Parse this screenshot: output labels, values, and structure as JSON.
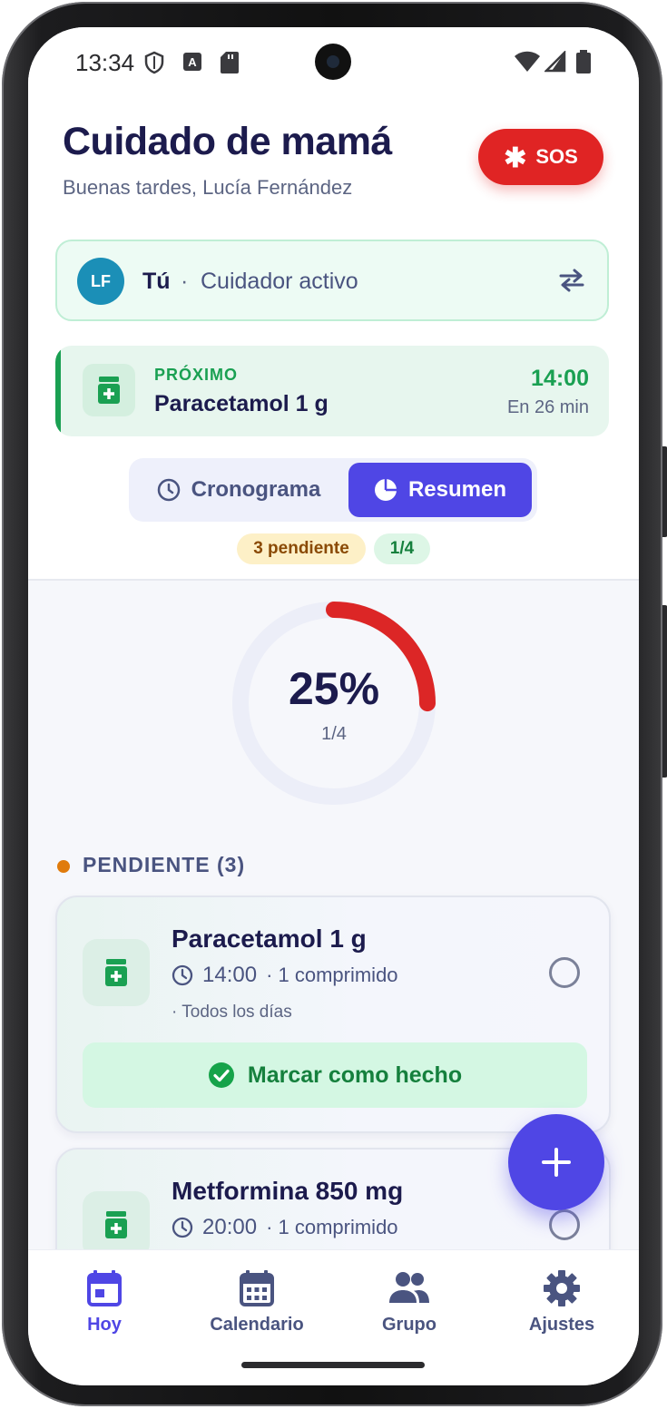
{
  "status_bar": {
    "time": "13:34"
  },
  "header": {
    "title": "Cuidado de mamá",
    "greeting": "Buenas tardes, Lucía Fernández",
    "sos_label": "SOS"
  },
  "caregiver": {
    "initials": "LF",
    "you": "Tú",
    "separator": "·",
    "role": "Cuidador activo"
  },
  "next_dose": {
    "label": "PRÓXIMO",
    "medication": "Paracetamol 1 g",
    "time": "14:00",
    "countdown": "En 26 min"
  },
  "view_toggle": {
    "options": [
      "Cronograma",
      "Resumen"
    ],
    "selected": "Resumen"
  },
  "badges": {
    "pending": "3 pendiente",
    "progress": "1/4"
  },
  "summary": {
    "percent_label": "25%",
    "fraction": "1/4",
    "progress": 0.25,
    "ring_color": "#dc2626"
  },
  "section": {
    "title": "PENDIENTE (3)"
  },
  "medications": [
    {
      "name": "Paracetamol 1 g",
      "time": "14:00",
      "dose": "· 1 comprimido",
      "frequency": "· Todos los días",
      "action": "Marcar como hecho"
    },
    {
      "name": "Metformina 850 mg",
      "time": "20:00",
      "dose": "· 1 comprimido"
    }
  ],
  "bottom_nav": {
    "items": [
      {
        "label": "Hoy",
        "icon": "calendar-today-icon",
        "active": true
      },
      {
        "label": "Calendario",
        "icon": "calendar-month-icon"
      },
      {
        "label": "Grupo",
        "icon": "group-icon"
      },
      {
        "label": "Ajustes",
        "icon": "gear-icon"
      }
    ]
  },
  "colors": {
    "primary": "#4f46e5",
    "success": "#1aa052",
    "danger": "#e02424",
    "warning": "#e07b0c"
  }
}
